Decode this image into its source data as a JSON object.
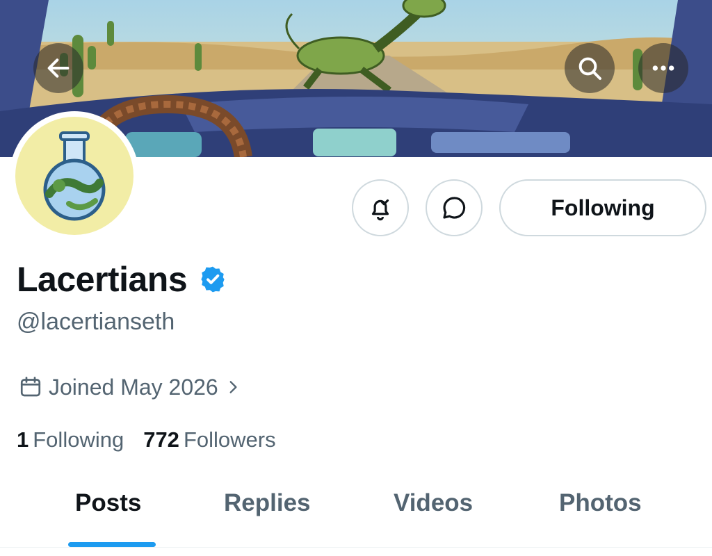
{
  "header": {
    "icons": {
      "back": "arrow-left-icon",
      "search": "search-icon",
      "more": "more-horizontal-icon"
    }
  },
  "profile": {
    "display_name": "Lacertians",
    "handle": "@lacertianseth",
    "verified": true,
    "verified_color": "#1d9bf0",
    "joined": "Joined May 2026",
    "following_count": "1",
    "following_label": "Following",
    "followers_count": "772",
    "followers_label": "Followers"
  },
  "actions": {
    "follow_state_label": "Following",
    "icons": {
      "notify": "bell-check-icon",
      "message": "message-bubble-icon"
    }
  },
  "tabs": [
    {
      "label": "Posts",
      "active": true
    },
    {
      "label": "Replies",
      "active": false
    },
    {
      "label": "Videos",
      "active": false
    },
    {
      "label": "Photos",
      "active": false
    }
  ],
  "colors": {
    "accent": "#1d9bf0",
    "text_primary": "#0f1419",
    "text_secondary": "#536471",
    "border": "#cfd9de"
  }
}
